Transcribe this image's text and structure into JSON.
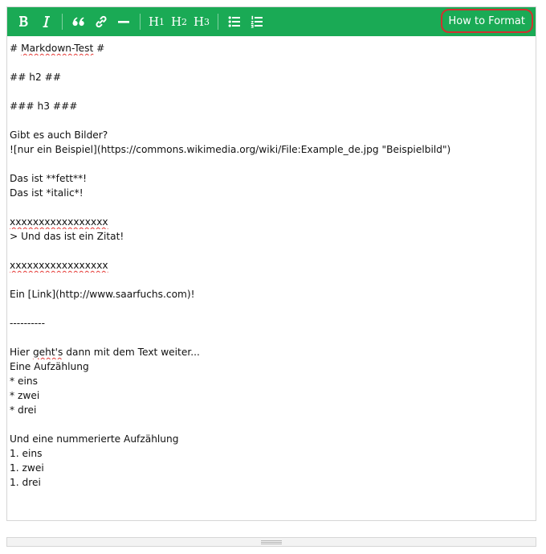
{
  "toolbar": {
    "accent_color": "#1aaa55",
    "h1": "H",
    "h1_sub": "1",
    "h2": "H",
    "h2_sub": "2",
    "h3": "H",
    "h3_sub": "3",
    "how_to_format": "How to Format"
  },
  "editor": {
    "lines": [
      {
        "pre": "# ",
        "spell": "Markdown-Test",
        "post": " #"
      },
      {
        "text": ""
      },
      {
        "text": "## h2 ##"
      },
      {
        "text": ""
      },
      {
        "text": "### h3 ###"
      },
      {
        "text": ""
      },
      {
        "text": "Gibt es auch Bilder?"
      },
      {
        "text": "![nur ein Beispiel](https://commons.wikimedia.org/wiki/File:Example_de.jpg \"Beispielbild\")"
      },
      {
        "text": ""
      },
      {
        "text": "Das ist **fett**!"
      },
      {
        "text": "Das ist *italic*!"
      },
      {
        "text": ""
      },
      {
        "spell": "xxxxxxxxxxxxxxxxx"
      },
      {
        "text": "> Und das ist ein Zitat!"
      },
      {
        "text": ""
      },
      {
        "spell": "xxxxxxxxxxxxxxxxx"
      },
      {
        "text": ""
      },
      {
        "text": "Ein [Link](http://www.saarfuchs.com)!"
      },
      {
        "text": ""
      },
      {
        "text": "----------"
      },
      {
        "text": ""
      },
      {
        "pre": "Hier ",
        "spell": "geht's",
        "post": " dann mit dem Text weiter..."
      },
      {
        "text": "Eine Aufzählung"
      },
      {
        "text": "* eins"
      },
      {
        "text": "* zwei"
      },
      {
        "text": "* drei"
      },
      {
        "text": ""
      },
      {
        "text": "Und eine nummerierte Aufzählung"
      },
      {
        "text": "1. eins"
      },
      {
        "text": "1. zwei"
      },
      {
        "text": "1. drei"
      }
    ]
  }
}
